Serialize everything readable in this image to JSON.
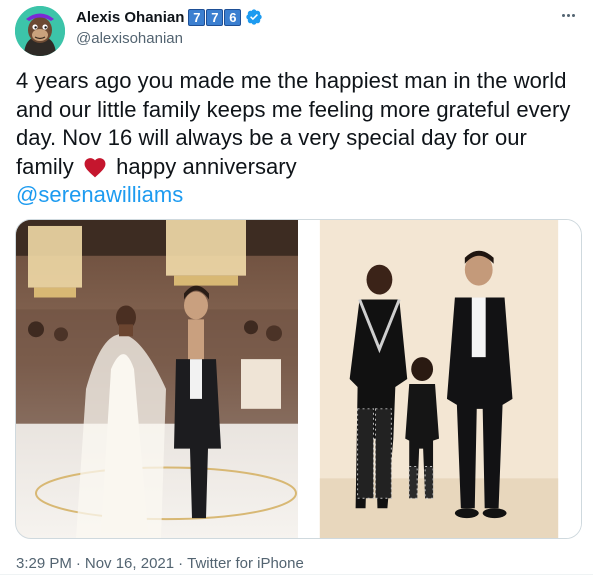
{
  "author": {
    "name": "Alexis Ohanian",
    "handle": "@alexisohanian",
    "digit_badges": [
      "7",
      "7",
      "6"
    ],
    "avatar_icon": "ape-avatar-icon",
    "verified_icon": "verified-badge-icon",
    "verified_color": "#1d9bf0"
  },
  "menu": {
    "icon": "more-options-icon"
  },
  "tweet": {
    "text_before_heart": "4 years ago you made me the happiest man in the world and our little family keeps me feeling more grateful every day. Nov 16 will always be a very special day for our family",
    "heart_icon": "red-heart-icon",
    "text_after_heart": "happy anniversary",
    "mention": "@serenawilliams",
    "mention_color": "#1d9bf0"
  },
  "media": {
    "photos": [
      {
        "icon": "wedding-photo"
      },
      {
        "icon": "family-portrait-photo"
      }
    ]
  },
  "meta": {
    "time": "3:29 PM",
    "separator": "·",
    "date": "Nov 16, 2021",
    "source": "Twitter for iPhone"
  }
}
